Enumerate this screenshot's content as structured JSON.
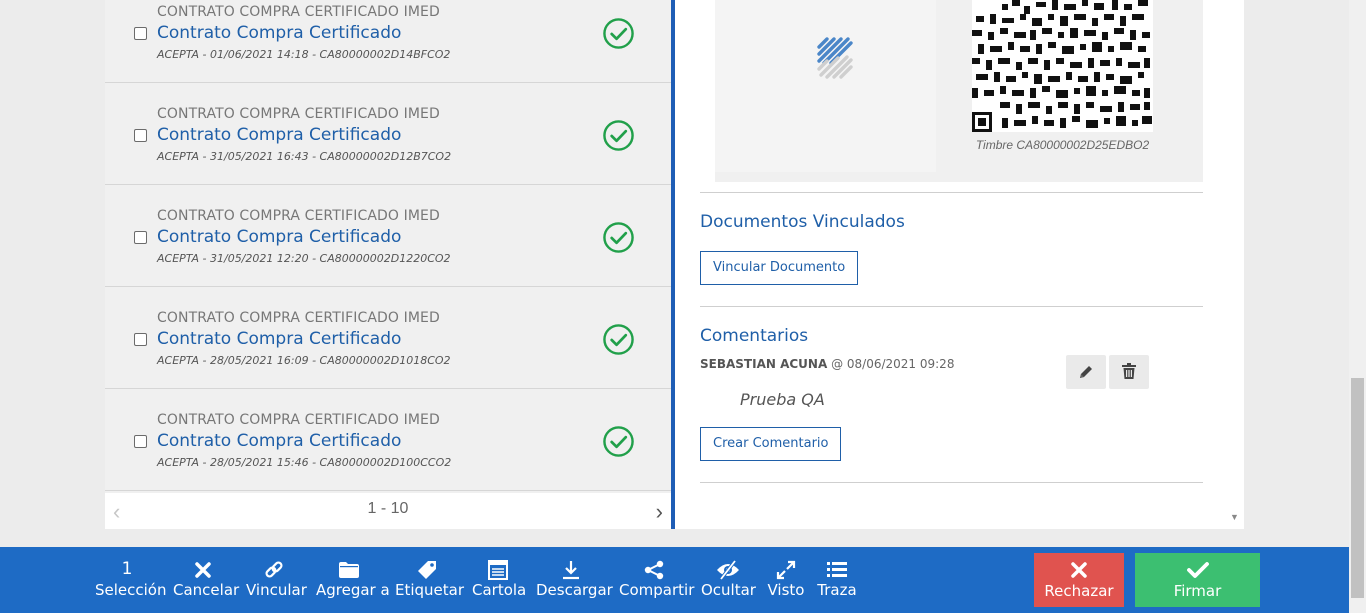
{
  "documents": [
    {
      "category": "CONTRATO COMPRA CERTIFICADO IMED",
      "title": "Contrato Compra Certificado",
      "meta": "ACEPTA - 01/06/2021 14:18 - CA80000002D14BFCO2"
    },
    {
      "category": "CONTRATO COMPRA CERTIFICADO IMED",
      "title": "Contrato Compra Certificado",
      "meta": "ACEPTA - 31/05/2021 16:43 - CA80000002D12B7CO2"
    },
    {
      "category": "CONTRATO COMPRA CERTIFICADO IMED",
      "title": "Contrato Compra Certificado",
      "meta": "ACEPTA - 31/05/2021 12:20 - CA80000002D1220CO2"
    },
    {
      "category": "CONTRATO COMPRA CERTIFICADO IMED",
      "title": "Contrato Compra Certificado",
      "meta": "ACEPTA - 28/05/2021 16:09 - CA80000002D1018CO2"
    },
    {
      "category": "CONTRATO COMPRA CERTIFICADO IMED",
      "title": "Contrato Compra Certificado",
      "meta": "ACEPTA - 28/05/2021 15:46 - CA80000002D100CCO2"
    }
  ],
  "pager": {
    "range": "1 - 10"
  },
  "preview": {
    "timbre": "Timbre CA80000002D25EDBO2"
  },
  "linked": {
    "title": "Documentos Vinculados",
    "button": "Vincular Documento"
  },
  "comments": {
    "title": "Comentarios",
    "author": "SEBASTIAN ACUNA",
    "date": "@ 08/06/2021 09:28",
    "text": "Prueba QA",
    "button": "Crear Comentario"
  },
  "actions": {
    "selection_count": "1",
    "selection": "Selección",
    "cancel": "Cancelar",
    "link": "Vincular",
    "add_to": "Agregar a",
    "tag": "Etiquetar",
    "cartola": "Cartola",
    "download": "Descargar",
    "share": "Compartir",
    "hide": "Ocultar",
    "viewed": "Visto",
    "trace": "Traza",
    "reject": "Rechazar",
    "sign": "Firmar"
  },
  "colors": {
    "accent": "#1e6bc5",
    "link": "#1f5fa8",
    "success": "#21a04a",
    "reject": "#e0534f",
    "sign": "#3cbf71"
  }
}
